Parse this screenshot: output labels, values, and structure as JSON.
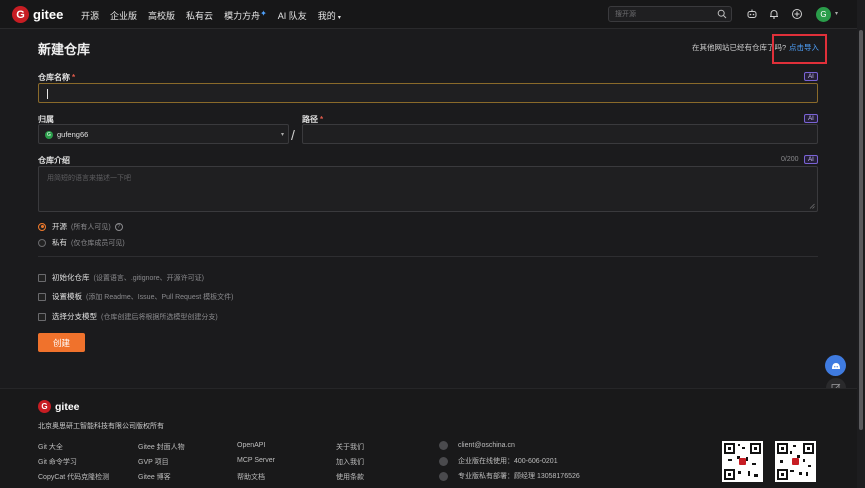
{
  "header": {
    "logo_letter": "G",
    "logo_text": "gitee",
    "nav": [
      {
        "label": "开源"
      },
      {
        "label": "企业版"
      },
      {
        "label": "高校版"
      },
      {
        "label": "私有云"
      },
      {
        "label": "模力方舟",
        "spark": "✦"
      },
      {
        "label": "AI 队友"
      },
      {
        "label": "我的",
        "caret": "▾"
      }
    ],
    "search_placeholder": "搜开源",
    "avatar_letter": "G"
  },
  "form": {
    "title": "新建仓库",
    "import_question": "在其他网站已经有仓库了吗?",
    "import_link": "点击导入",
    "repo_name_label": "仓库名称",
    "required_mark": "*",
    "ai_badge": "AI",
    "owner_label": "归属",
    "owner_name": "gufeng66",
    "owner_avatar": "G",
    "path_label": "路径",
    "path_separator": "/",
    "intro_label": "仓库介绍",
    "intro_counter": "0/200",
    "intro_placeholder": "用简短的语言来描述一下吧",
    "visibility": [
      {
        "label": "开源",
        "hint": "(所有人可见)",
        "selected": true
      },
      {
        "label": "私有",
        "hint": "(仅仓库成员可见)",
        "selected": false
      }
    ],
    "options": [
      {
        "label": "初始化仓库",
        "hint": "(设置语言、.gitignore、开源许可证)"
      },
      {
        "label": "设置模板",
        "hint": "(添加 Readme、Issue、Pull Request 模板文件)"
      },
      {
        "label": "选择分支模型",
        "hint": "(仓库创建后将根据所选模型创建分支)"
      }
    ],
    "create_button": "创建"
  },
  "footer": {
    "logo_letter": "G",
    "logo_text": "gitee",
    "company": "北京奥思研工智能科技有限公司版权所有",
    "col1": [
      "Git 大全",
      "Git 命令学习",
      "CopyCat 代码克隆检测"
    ],
    "col2": [
      "Gitee 封面人物",
      "GVP 项目",
      "Gitee 博客"
    ],
    "col3": [
      "OpenAPI",
      "MCP Server",
      "帮助文档"
    ],
    "col4": [
      "关于我们",
      "加入我们",
      "使用条款"
    ],
    "contacts": [
      "client@oschina.cn",
      "企业版在线使用：400-606-0201",
      "专业版私有部署：顾经理 13058176526"
    ]
  }
}
